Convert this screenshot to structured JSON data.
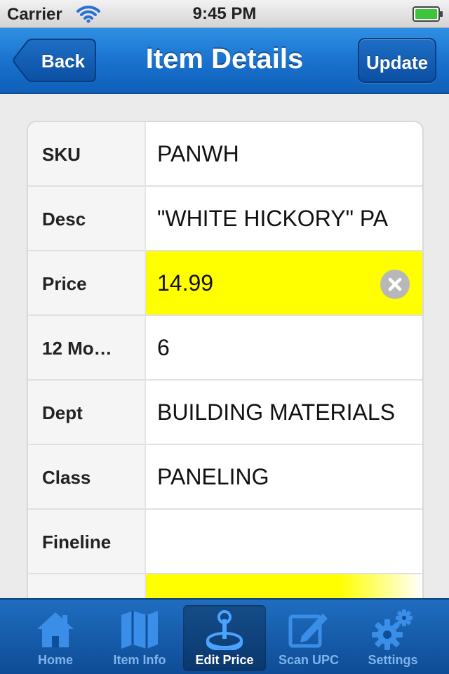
{
  "status_bar": {
    "carrier": "Carrier",
    "time": "9:45 PM",
    "wifi_icon": "wifi-icon",
    "battery_icon": "battery-icon"
  },
  "nav_bar": {
    "title": "Item Details",
    "back_label": "Back",
    "update_label": "Update"
  },
  "fields": [
    {
      "label": "SKU",
      "value": "PANWH"
    },
    {
      "label": "Desc",
      "value": "\"WHITE HICKORY\" PA"
    },
    {
      "label": "Price",
      "value": "14.99"
    },
    {
      "label": "12 Mo…",
      "value": "6"
    },
    {
      "label": "Dept",
      "value": "BUILDING MATERIALS"
    },
    {
      "label": "Class",
      "value": "PANELING"
    },
    {
      "label": "Fineline",
      "value": ""
    }
  ],
  "tabs": [
    {
      "label": "Home",
      "icon": "home-icon"
    },
    {
      "label": "Item Info",
      "icon": "map-icon"
    },
    {
      "label": "Edit Price",
      "icon": "joystick-icon",
      "selected": true
    },
    {
      "label": "Scan UPC",
      "icon": "edit-icon"
    },
    {
      "label": "Settings",
      "icon": "gear-icon"
    }
  ],
  "colors": {
    "nav_blue": "#1a73cf",
    "highlight_yellow": "#ffff00",
    "tab_bar_blue": "#0e4c96"
  }
}
